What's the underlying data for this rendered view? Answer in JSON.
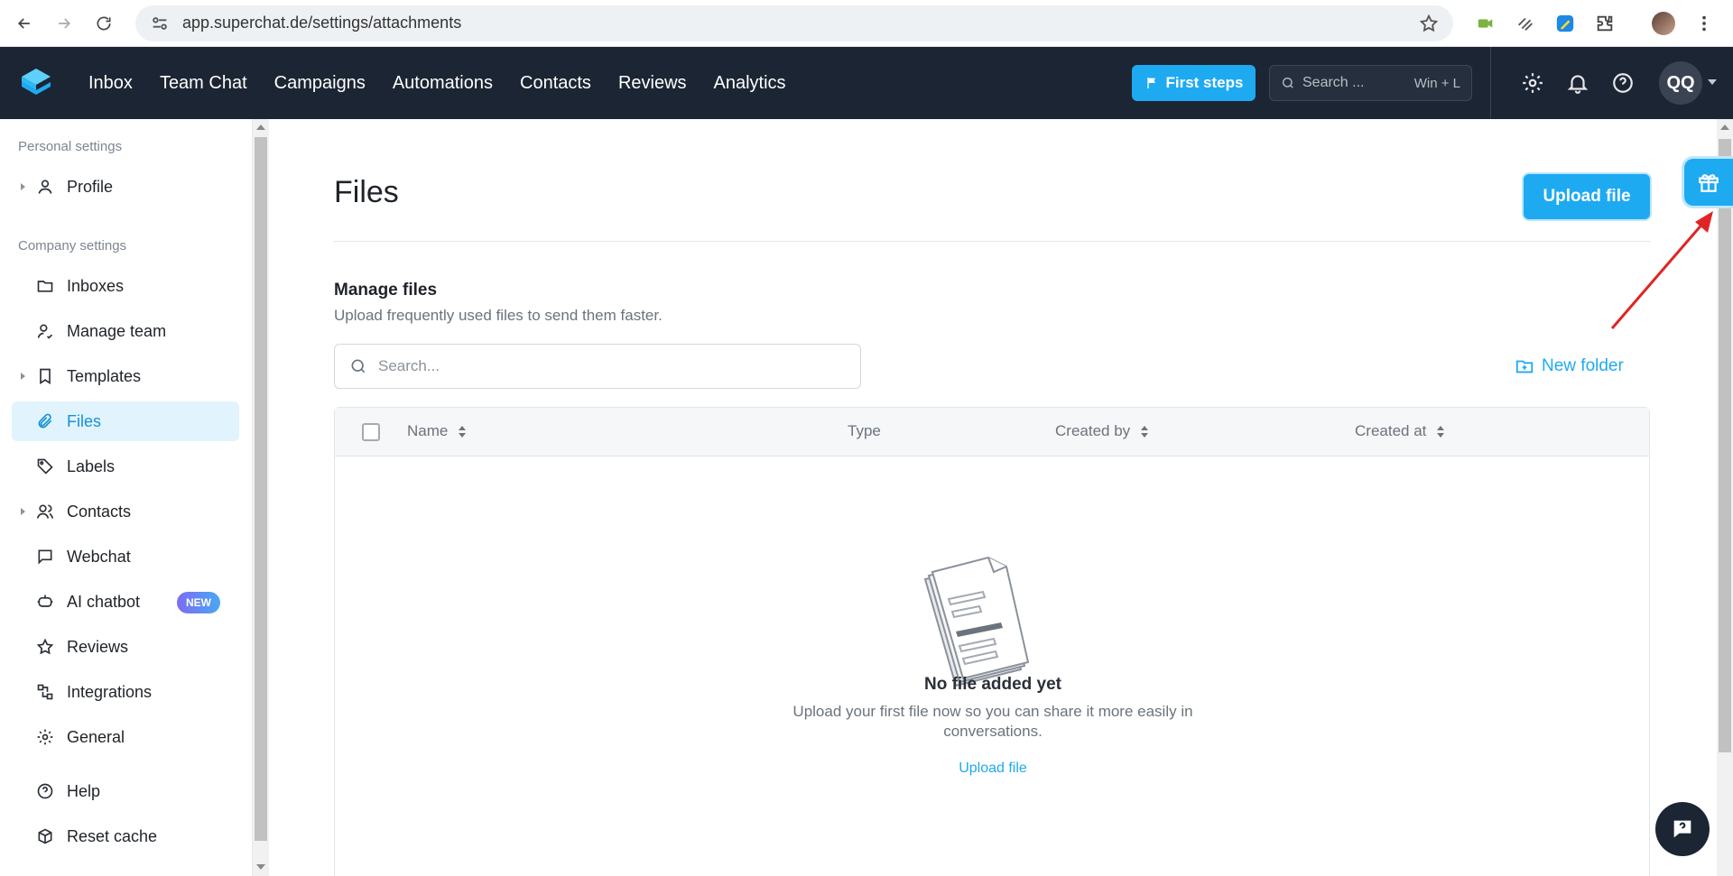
{
  "browser": {
    "url": "app.superchat.de/settings/attachments"
  },
  "header": {
    "nav": [
      "Inbox",
      "Team Chat",
      "Campaigns",
      "Automations",
      "Contacts",
      "Reviews",
      "Analytics"
    ],
    "first_steps": "First steps",
    "search_placeholder": "Search ...",
    "search_shortcut": "Win + L",
    "user_initials": "QQ"
  },
  "sidebar": {
    "personal_heading": "Personal settings",
    "company_heading": "Company settings",
    "items": [
      {
        "label": "Profile",
        "icon": "user-icon",
        "expandable": true
      },
      {
        "label": "Inboxes",
        "icon": "folder-icon",
        "expandable": false
      },
      {
        "label": "Manage team",
        "icon": "user-check-icon",
        "expandable": false
      },
      {
        "label": "Templates",
        "icon": "bookmark-icon",
        "expandable": true
      },
      {
        "label": "Files",
        "icon": "paperclip-icon",
        "expandable": false,
        "active": true
      },
      {
        "label": "Labels",
        "icon": "tag-icon",
        "expandable": false
      },
      {
        "label": "Contacts",
        "icon": "users-icon",
        "expandable": true
      },
      {
        "label": "Webchat",
        "icon": "message-square-icon",
        "expandable": false
      },
      {
        "label": "AI chatbot",
        "icon": "bot-icon",
        "expandable": false,
        "badge": "NEW"
      },
      {
        "label": "Reviews",
        "icon": "star-icon",
        "expandable": false
      },
      {
        "label": "Integrations",
        "icon": "integrations-icon",
        "expandable": false
      },
      {
        "label": "General",
        "icon": "gear-icon",
        "expandable": false
      },
      {
        "label": "Help",
        "icon": "help-circle-icon",
        "expandable": false
      },
      {
        "label": "Reset cache",
        "icon": "box-icon",
        "expandable": false
      }
    ]
  },
  "main": {
    "title": "Files",
    "upload_button": "Upload file",
    "section_title": "Manage files",
    "section_subtitle": "Upload frequently used files to send them faster.",
    "search_placeholder": "Search...",
    "new_folder": "New folder",
    "table": {
      "columns": [
        "Name",
        "Type",
        "Created by",
        "Created at"
      ]
    },
    "empty": {
      "title": "No file added yet",
      "subtitle": "Upload your first file now so you can share it more easily in conversations.",
      "link": "Upload file"
    }
  },
  "colors": {
    "accent": "#1eaaf1",
    "header_bg": "#1c2533",
    "active_bg": "#e1f4fd"
  }
}
